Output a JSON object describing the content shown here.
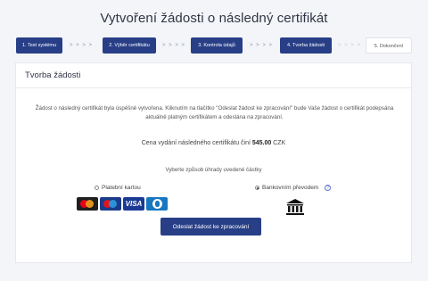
{
  "page": {
    "title": "Vytvoření žádosti o následný certifikát"
  },
  "steps": [
    {
      "label": "1. Test systému",
      "state": "done"
    },
    {
      "label": "2. Výběr certifikátu",
      "state": "done"
    },
    {
      "label": "3. Kontrola údajů",
      "state": "done"
    },
    {
      "label": "4. Tvorba žádosti",
      "state": "current"
    },
    {
      "label": "5. Dokončení",
      "state": "pending"
    }
  ],
  "step_separator": "> > > >",
  "card": {
    "title": "Tvorba žádosti",
    "intro": "Žádost o následný certifikát byla úspěšně vytvořena. Kliknutím na tlačítko \"Odeslat žádost ke zpracování\" bude Vaše žádost o certifikát podepsána aktuálně platným certifikátem a odeslána na zpracování.",
    "price_prefix": "Cena vydání následného certifikátu činí",
    "price_value": "545.00",
    "price_currency": "CZK",
    "choose_text": "Vyberte způsob úhrady uvedené částky",
    "payment_options": [
      {
        "label": "Platební kartou",
        "selected": false
      },
      {
        "label": "Bankovním převodem",
        "selected": true
      }
    ],
    "card_brands": [
      "Mastercard",
      "Maestro",
      "VISA",
      "Diners Club"
    ],
    "visa_text": "VISA",
    "submit_label": "Odeslat žádost ke zpracování"
  },
  "icons": {
    "help": "help-icon",
    "bank": "bank-icon"
  },
  "colors": {
    "primary": "#283f87",
    "background": "#f4f5f8"
  }
}
